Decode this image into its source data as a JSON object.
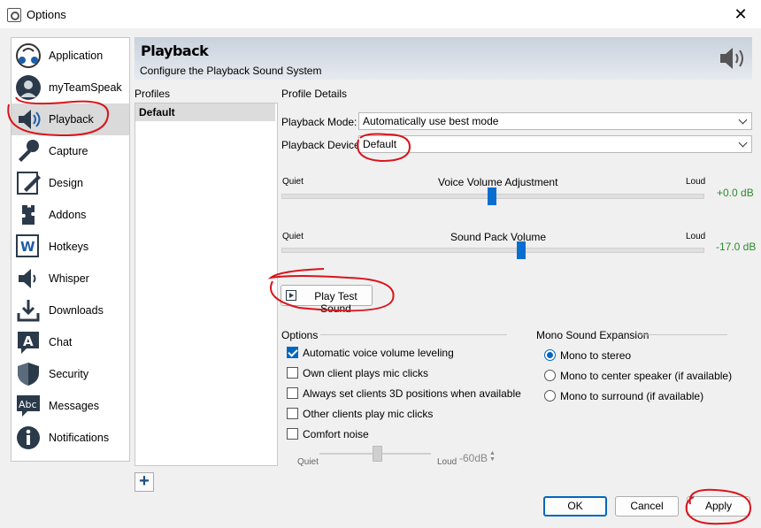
{
  "window": {
    "title": "Options"
  },
  "sidebar": {
    "items": [
      {
        "label": "Application",
        "icon": "application-icon"
      },
      {
        "label": "myTeamSpeak",
        "icon": "myteamspeak-icon"
      },
      {
        "label": "Playback",
        "icon": "speaker-icon",
        "selected": true
      },
      {
        "label": "Capture",
        "icon": "microphone-icon"
      },
      {
        "label": "Design",
        "icon": "design-icon"
      },
      {
        "label": "Addons",
        "icon": "puzzle-icon"
      },
      {
        "label": "Hotkeys",
        "icon": "hotkeys-icon"
      },
      {
        "label": "Whisper",
        "icon": "whisper-icon"
      },
      {
        "label": "Downloads",
        "icon": "download-icon"
      },
      {
        "label": "Chat",
        "icon": "chat-icon"
      },
      {
        "label": "Security",
        "icon": "shield-icon"
      },
      {
        "label": "Messages",
        "icon": "messages-icon"
      },
      {
        "label": "Notifications",
        "icon": "info-icon"
      }
    ]
  },
  "header": {
    "title": "Playback",
    "subtitle": "Configure the Playback Sound System"
  },
  "profiles": {
    "label": "Profiles",
    "items": [
      "Default"
    ]
  },
  "details": {
    "label": "Profile Details",
    "playback_mode_label": "Playback Mode:",
    "playback_mode_value": "Automatically use best mode",
    "playback_device_label": "Playback Device:",
    "playback_device_value": "Default"
  },
  "voice_volume": {
    "title": "Voice Volume Adjustment",
    "quiet": "Quiet",
    "loud": "Loud",
    "value": "+0.0 dB",
    "position": 0.5
  },
  "soundpack_volume": {
    "title": "Sound Pack Volume",
    "quiet": "Quiet",
    "loud": "Loud",
    "value": "-17.0 dB",
    "position": 0.57
  },
  "play_test_sound": "Play Test Sound",
  "options": {
    "title": "Options",
    "items": [
      {
        "label": "Automatic voice volume leveling",
        "checked": true
      },
      {
        "label": "Own client plays mic clicks",
        "checked": false
      },
      {
        "label": "Always set clients 3D positions when available",
        "checked": false
      },
      {
        "label": "Other clients play mic clicks",
        "checked": false
      },
      {
        "label": "Comfort noise",
        "checked": false
      }
    ],
    "comfort_quiet": "Quiet",
    "comfort_loud": "Loud",
    "comfort_value": "-60dB"
  },
  "mono": {
    "title": "Mono Sound Expansion",
    "items": [
      {
        "label": "Mono to stereo",
        "checked": true
      },
      {
        "label": "Mono to center speaker (if available)",
        "checked": false
      },
      {
        "label": "Mono to surround (if available)",
        "checked": false
      }
    ]
  },
  "footer": {
    "ok": "OK",
    "cancel": "Cancel",
    "apply": "Apply"
  },
  "colors": {
    "accent": "#0067c0",
    "slider": "#0a6ed1",
    "green_value": "#2d8a2d",
    "annotation": "#d9141b"
  }
}
